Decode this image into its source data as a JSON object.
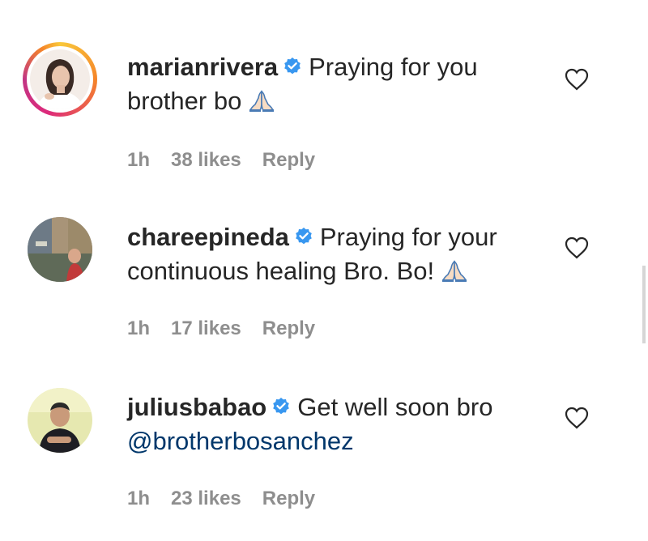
{
  "comments": [
    {
      "username": "marianrivera",
      "text_line1": "Praying for you",
      "text_line2": "brother bo",
      "emoji_icon": "folded-hands-icon",
      "time": "1h",
      "likes": "38 likes",
      "reply": "Reply",
      "avatar_has_story_ring": true
    },
    {
      "username": "chareepineda",
      "text_line1": "Praying for your",
      "text_line2": "continuous healing Bro. Bo!",
      "emoji_icon": "folded-hands-icon",
      "time": "1h",
      "likes": "17 likes",
      "reply": "Reply",
      "avatar_has_story_ring": false
    },
    {
      "username": "juliusbabao",
      "text_line1": "Get well soon bro",
      "mention": "@brotherbosanchez",
      "time": "1h",
      "likes": "23 likes",
      "reply": "Reply",
      "avatar_has_story_ring": false
    }
  ],
  "colors": {
    "text": "#262626",
    "meta": "#8e8e8e",
    "verified": "#3897f0",
    "mention": "#00376b"
  }
}
